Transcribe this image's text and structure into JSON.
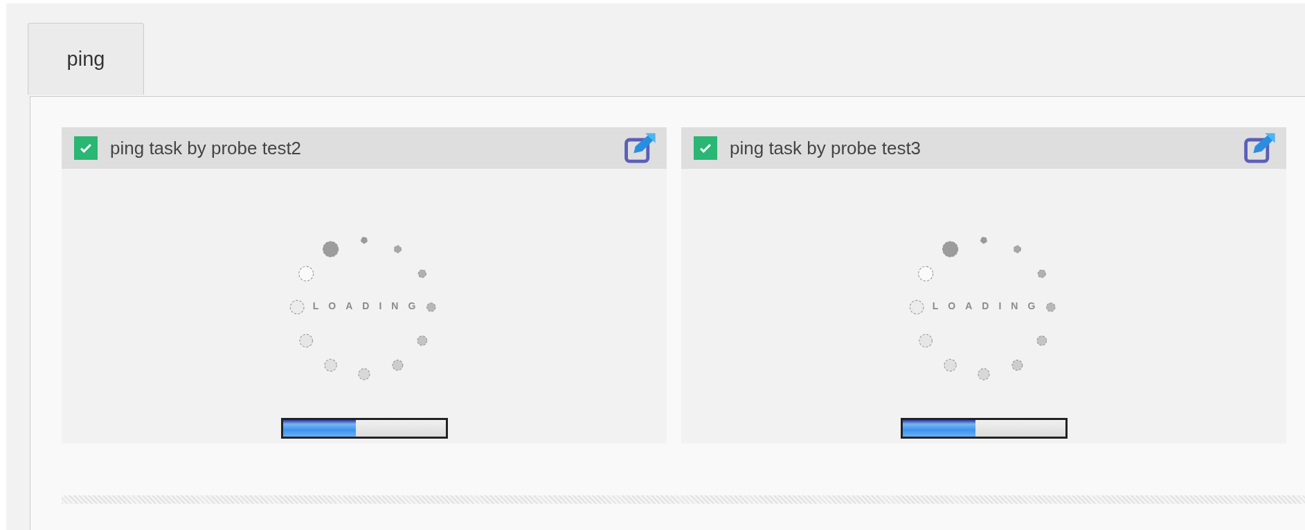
{
  "tabs": [
    {
      "label": "ping",
      "selected": true
    }
  ],
  "panels": [
    {
      "title": "ping task by probe test2",
      "checked": true,
      "loading_text": "LOADING",
      "level": 0.45
    },
    {
      "title": "ping task by probe test3",
      "checked": true,
      "loading_text": "LOADING",
      "level": 0.45
    }
  ]
}
